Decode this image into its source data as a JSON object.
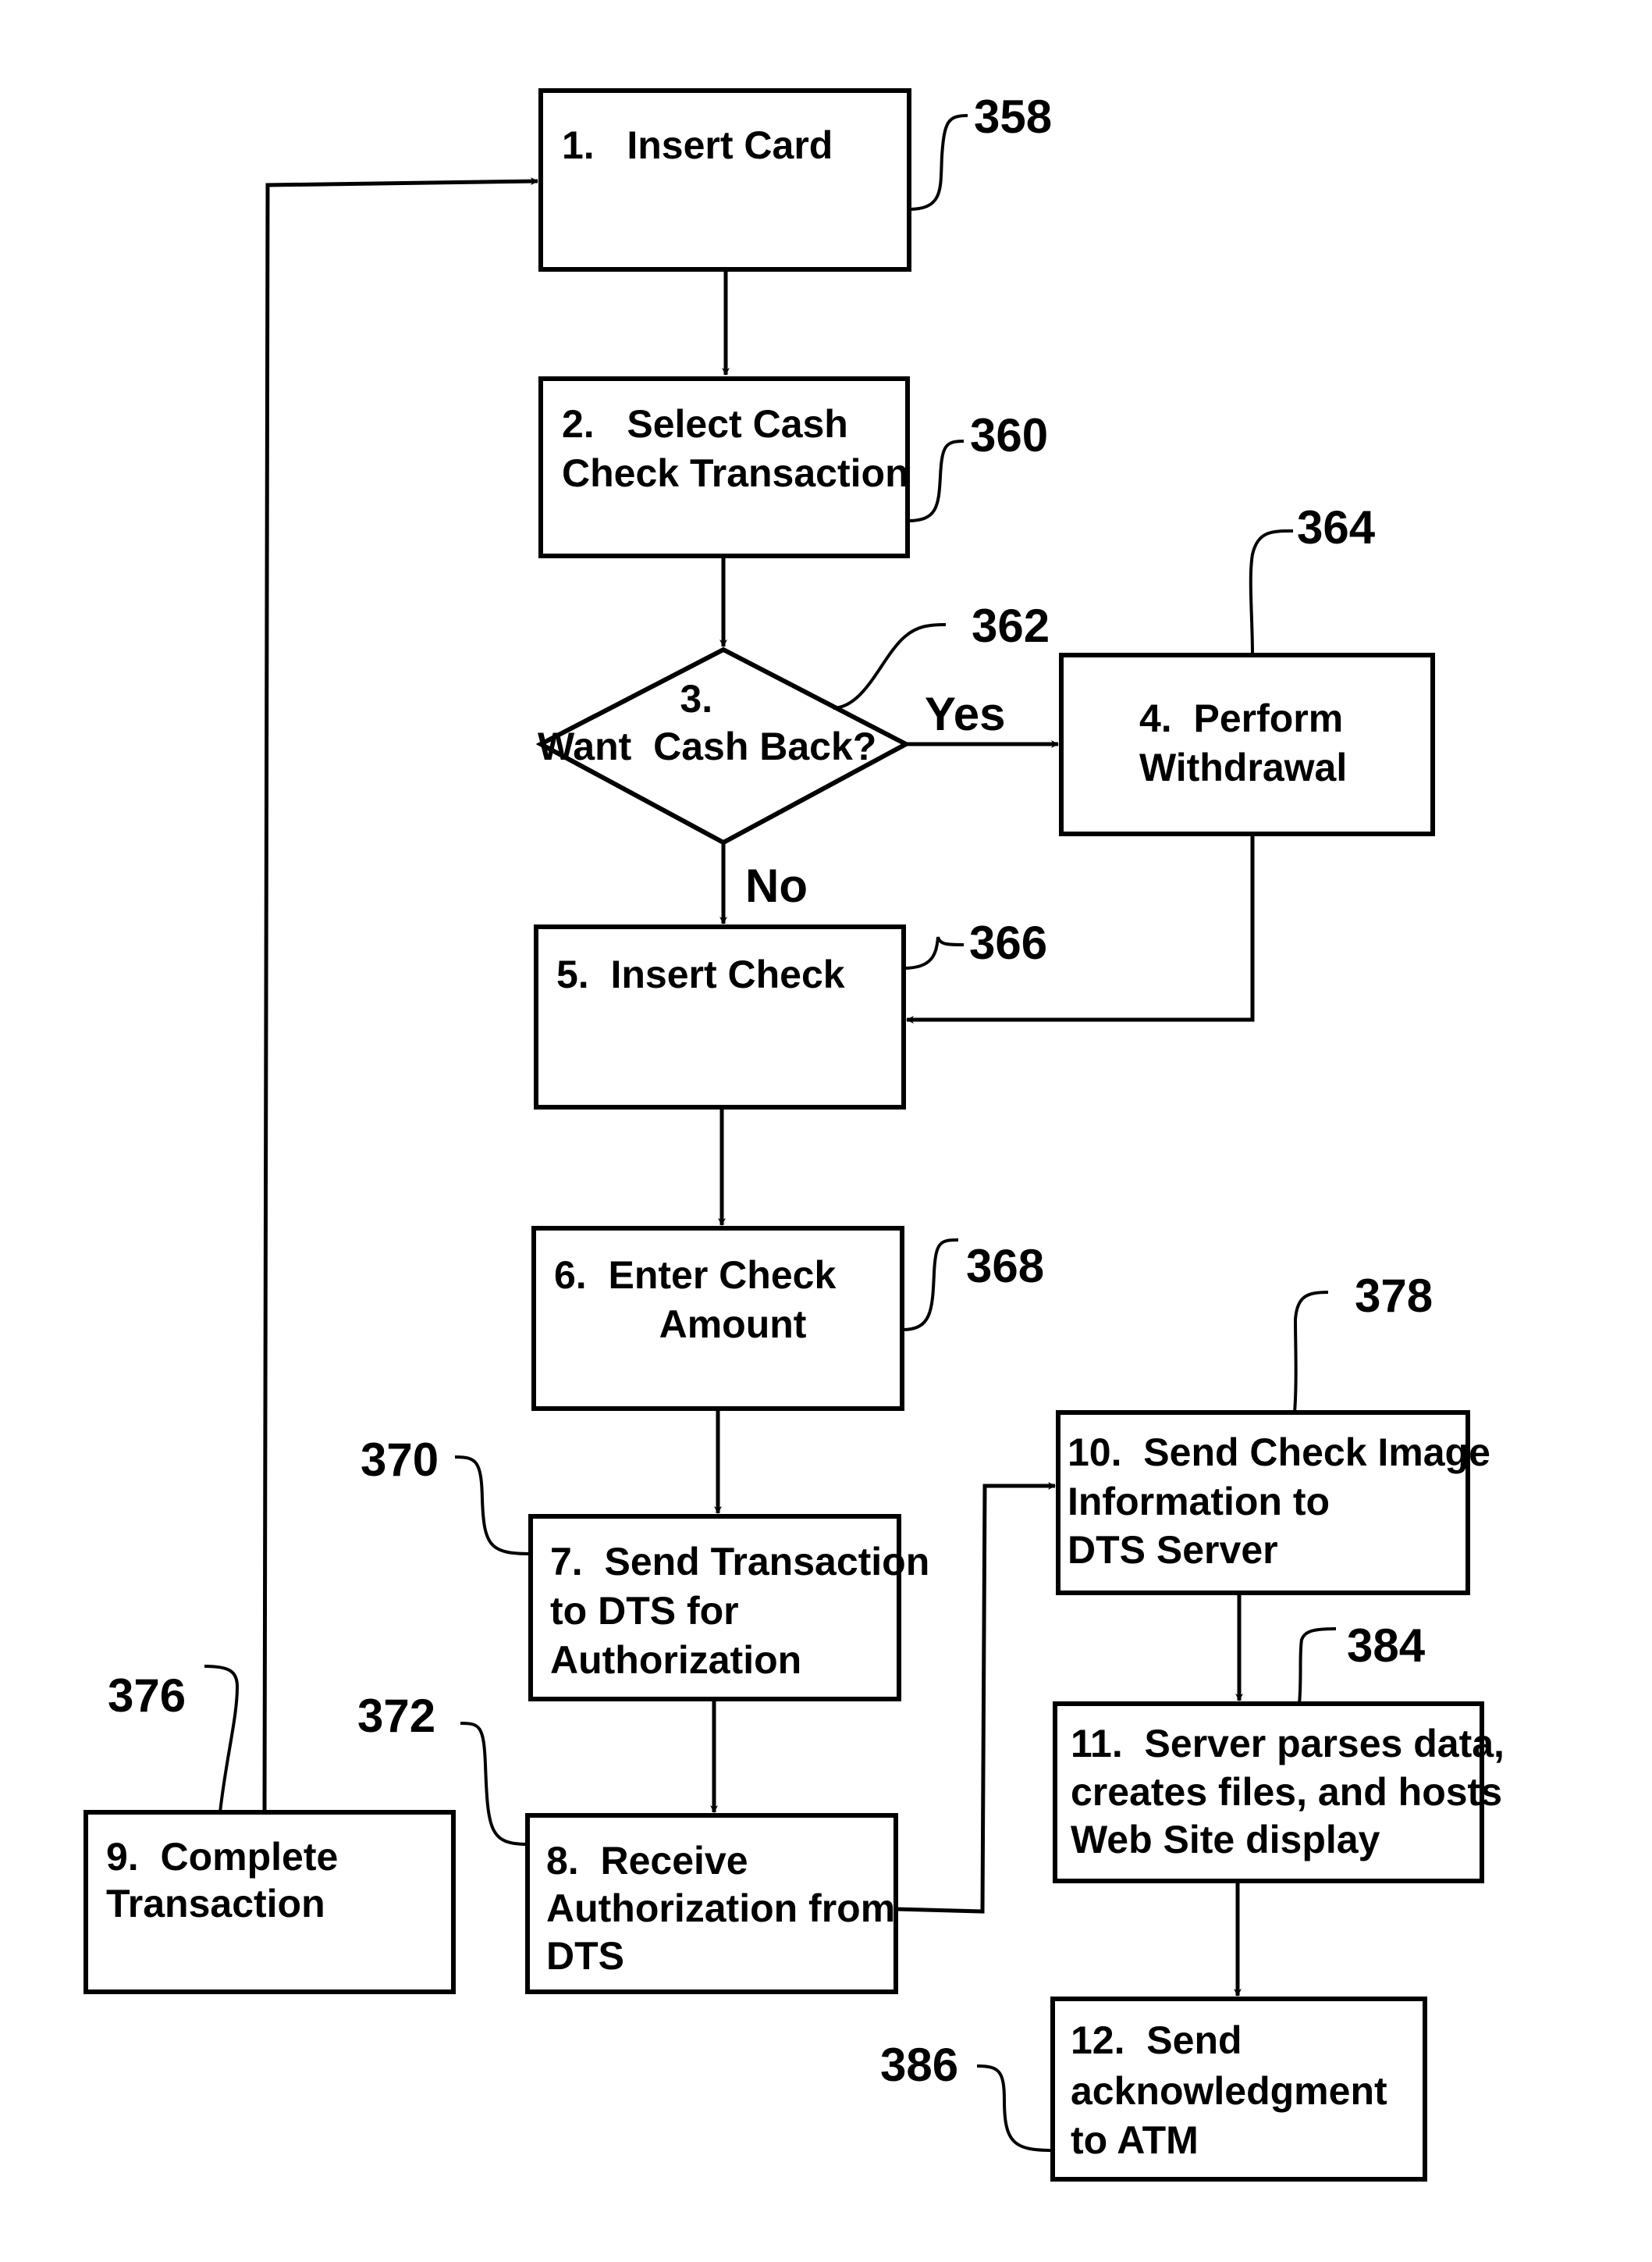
{
  "figure": {
    "steps": [
      {
        "id": "358",
        "lines": [
          "1.   Insert Card"
        ]
      },
      {
        "id": "360",
        "lines": [
          "2.   Select Cash",
          "Check Transaction"
        ]
      },
      {
        "id": "362",
        "lines": [
          "3.",
          "Want  Cash Back?"
        ]
      },
      {
        "id": "364",
        "lines": [
          "4.  Perform",
          "Withdrawal"
        ]
      },
      {
        "id": "366",
        "lines": [
          "5.  Insert Check"
        ]
      },
      {
        "id": "368",
        "lines": [
          "6.  Enter Check",
          "     Amount"
        ]
      },
      {
        "id": "370",
        "lines": [
          "7.  Send Transaction",
          "to DTS for",
          "Authorization"
        ]
      },
      {
        "id": "372",
        "lines": [
          "8.  Receive",
          "Authorization from",
          "DTS"
        ]
      },
      {
        "id": "376",
        "lines": [
          "9.  Complete",
          "Transaction"
        ]
      },
      {
        "id": "378",
        "lines": [
          "10.  Send Check Image",
          "Information to",
          "DTS Server"
        ]
      },
      {
        "id": "384",
        "lines": [
          "11.  Server parses data,",
          "creates files, and hosts",
          "Web Site display"
        ]
      },
      {
        "id": "386",
        "lines": [
          "12.  Send",
          "acknowledgment",
          "to ATM"
        ]
      }
    ],
    "branch_labels": {
      "yes": "Yes",
      "no": "No"
    },
    "ref_numbers": [
      "358",
      "360",
      "362",
      "364",
      "366",
      "368",
      "370",
      "372",
      "376",
      "378",
      "384",
      "386"
    ]
  }
}
